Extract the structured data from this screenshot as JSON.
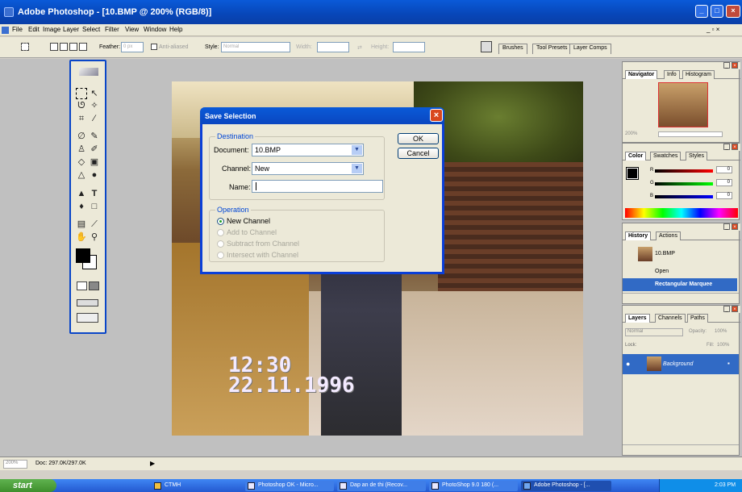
{
  "window": {
    "title": "Adobe Photoshop - [10.BMP @ 200% (RGB/8)]",
    "minimize": "_",
    "maximize": "□",
    "close": "×",
    "doc_restore": "_ ▫ ×"
  },
  "menu": [
    "File",
    "Edit",
    "Image",
    "Layer",
    "Select",
    "Filter",
    "View",
    "Window",
    "Help"
  ],
  "options": {
    "feather_label": "Feather:",
    "feather_value": "0 px",
    "antialiased_label": "Anti-aliased",
    "style_label": "Style:",
    "style_value": "Normal",
    "width_label": "Width:",
    "height_label": "Height:",
    "palette_tabs": [
      "Brushes",
      "Tool Presets",
      "Layer Comps"
    ]
  },
  "canvas": {
    "time_stamp": "12:30",
    "date_stamp": "22.11.1996"
  },
  "dialog": {
    "title": "Save Selection",
    "destination_label": "Destination",
    "document_label": "Document:",
    "document_value": "10.BMP",
    "channel_label": "Channel:",
    "channel_value": "New",
    "name_label": "Name:",
    "name_value": "",
    "operation_label": "Operation",
    "operations": [
      {
        "label": "New Channel",
        "selected": true,
        "enabled": true
      },
      {
        "label": "Add to Channel",
        "selected": false,
        "enabled": false
      },
      {
        "label": "Subtract from Channel",
        "selected": false,
        "enabled": false
      },
      {
        "label": "Intersect with Channel",
        "selected": false,
        "enabled": false
      }
    ],
    "ok_label": "OK",
    "cancel_label": "Cancel"
  },
  "navigator": {
    "tabs": [
      "Navigator",
      "Info",
      "Histogram"
    ],
    "zoom": "200%"
  },
  "color": {
    "tabs": [
      "Color",
      "Swatches",
      "Styles"
    ],
    "channels": [
      "R",
      "G",
      "B"
    ],
    "values": [
      "0",
      "0",
      "0"
    ]
  },
  "history": {
    "tabs": [
      "History",
      "Actions"
    ],
    "snapshot": "10.BMP",
    "items": [
      "Open",
      "Rectangular Marquee"
    ]
  },
  "layers": {
    "tabs": [
      "Layers",
      "Channels",
      "Paths"
    ],
    "blend_mode": "Normal",
    "opacity_label": "Opacity:",
    "opacity_value": "100%",
    "lock_label": "Lock:",
    "fill_label": "Fill:",
    "fill_value": "100%",
    "layer_name": "Background"
  },
  "status": {
    "zoom": "200%",
    "doc": "Doc: 297.0K/297.0K"
  },
  "taskbar": {
    "start": "start",
    "items": [
      "CTMH",
      "Photoshop OK - Micro...",
      "Dap an de thi (Recov...",
      "PhotoShop 9.0 180 (...",
      "Adobe Photoshop - [..."
    ],
    "clock": "2:03 PM"
  }
}
